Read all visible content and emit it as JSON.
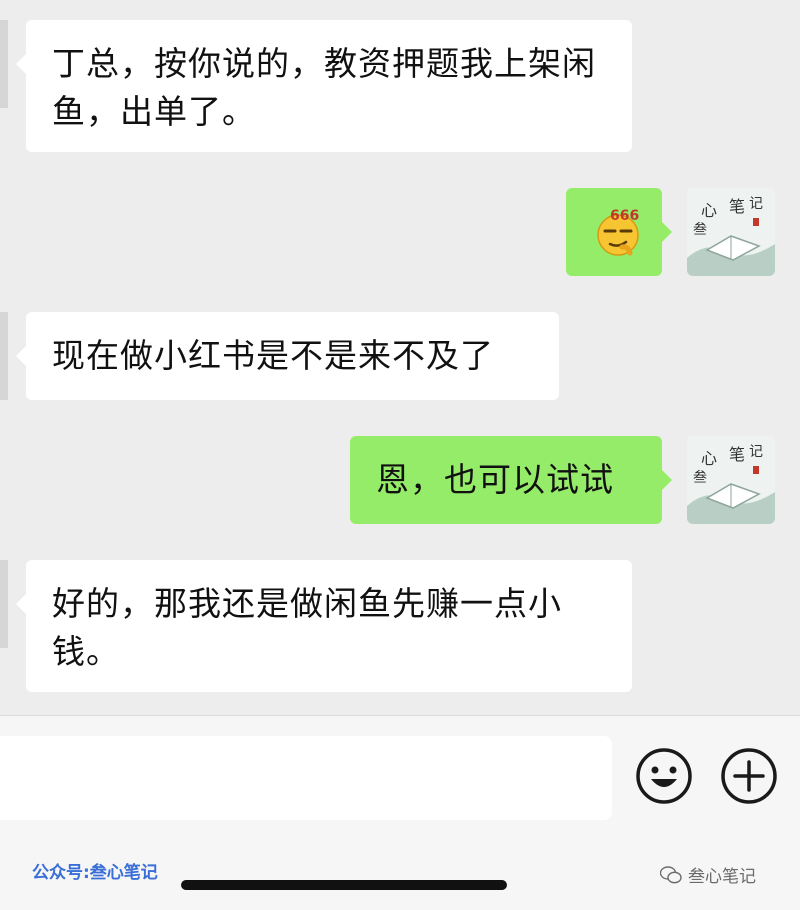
{
  "messages": [
    {
      "side": "received",
      "text": "丁总，按你说的，教资押题我上架闲鱼，出单了。"
    },
    {
      "side": "sent",
      "type": "sticker",
      "sticker_text": "666",
      "icon": "smirk-emoji-icon"
    },
    {
      "side": "received",
      "text": "现在做小红书是不是来不及了"
    },
    {
      "side": "sent",
      "text": "恩，也可以试试"
    },
    {
      "side": "received",
      "text": "好的，那我还是做闲鱼先赚一点小钱。"
    }
  ],
  "my_avatar": {
    "text": "叁心笔记"
  },
  "input_bar": {
    "value": "",
    "emoji_icon": "smiley-icon",
    "plus_icon": "plus-circle-icon"
  },
  "watermark": {
    "left": "公众号:叁心笔记",
    "right": "叁心笔记"
  }
}
